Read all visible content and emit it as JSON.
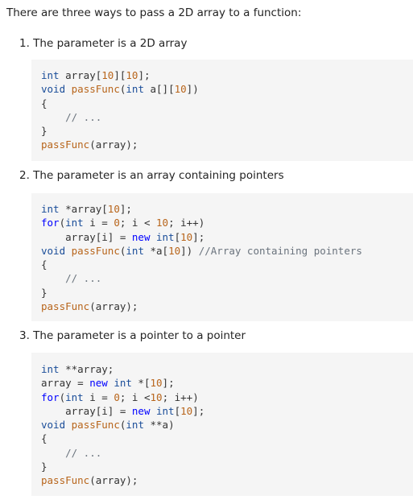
{
  "intro": "There are three ways to pass a 2D array to a function:",
  "sections": [
    {
      "heading": "1. The parameter is a 2D array",
      "code": [
        [
          [
            "ty",
            "int"
          ],
          [
            "p",
            " array["
          ],
          [
            "num",
            "10"
          ],
          [
            "p",
            "]["
          ],
          [
            "num",
            "10"
          ],
          [
            "p",
            "];"
          ]
        ],
        [
          [
            "ty",
            "void"
          ],
          [
            "p",
            " "
          ],
          [
            "fn",
            "passFunc"
          ],
          [
            "p",
            "("
          ],
          [
            "ty",
            "int"
          ],
          [
            "p",
            " a[]["
          ],
          [
            "num",
            "10"
          ],
          [
            "p",
            "])"
          ]
        ],
        [
          [
            "p",
            "{"
          ]
        ],
        [
          [
            "cm",
            "    // ..."
          ]
        ],
        [
          [
            "p",
            "}"
          ]
        ],
        [
          [
            "fn",
            "passFunc"
          ],
          [
            "p",
            "(array);"
          ]
        ]
      ]
    },
    {
      "heading": "2. The parameter is an array containing pointers",
      "code": [
        [
          [
            "ty",
            "int"
          ],
          [
            "p",
            " *array["
          ],
          [
            "num",
            "10"
          ],
          [
            "p",
            "];"
          ]
        ],
        [
          [
            "kw",
            "for"
          ],
          [
            "p",
            "("
          ],
          [
            "ty",
            "int"
          ],
          [
            "p",
            " i = "
          ],
          [
            "num",
            "0"
          ],
          [
            "p",
            "; i < "
          ],
          [
            "num",
            "10"
          ],
          [
            "p",
            "; i++)"
          ]
        ],
        [
          [
            "p",
            "    array[i] = "
          ],
          [
            "kw",
            "new"
          ],
          [
            "p",
            " "
          ],
          [
            "ty",
            "int"
          ],
          [
            "p",
            "["
          ],
          [
            "num",
            "10"
          ],
          [
            "p",
            "];"
          ]
        ],
        [
          [
            "ty",
            "void"
          ],
          [
            "p",
            " "
          ],
          [
            "fn",
            "passFunc"
          ],
          [
            "p",
            "("
          ],
          [
            "ty",
            "int"
          ],
          [
            "p",
            " *a["
          ],
          [
            "num",
            "10"
          ],
          [
            "p",
            "]) "
          ],
          [
            "cm",
            "//Array containing pointers"
          ]
        ],
        [
          [
            "p",
            "{"
          ]
        ],
        [
          [
            "cm",
            "    // ..."
          ]
        ],
        [
          [
            "p",
            "}"
          ]
        ],
        [
          [
            "fn",
            "passFunc"
          ],
          [
            "p",
            "(array);"
          ]
        ]
      ]
    },
    {
      "heading": "3. The parameter is a pointer to a pointer",
      "code": [
        [
          [
            "ty",
            "int"
          ],
          [
            "p",
            " **array;"
          ]
        ],
        [
          [
            "p",
            "array = "
          ],
          [
            "kw",
            "new"
          ],
          [
            "p",
            " "
          ],
          [
            "ty",
            "int"
          ],
          [
            "p",
            " *["
          ],
          [
            "num",
            "10"
          ],
          [
            "p",
            "];"
          ]
        ],
        [
          [
            "kw",
            "for"
          ],
          [
            "p",
            "("
          ],
          [
            "ty",
            "int"
          ],
          [
            "p",
            " i = "
          ],
          [
            "num",
            "0"
          ],
          [
            "p",
            "; i <"
          ],
          [
            "num",
            "10"
          ],
          [
            "p",
            "; i++)"
          ]
        ],
        [
          [
            "p",
            "    array[i] = "
          ],
          [
            "kw",
            "new"
          ],
          [
            "p",
            " "
          ],
          [
            "ty",
            "int"
          ],
          [
            "p",
            "["
          ],
          [
            "num",
            "10"
          ],
          [
            "p",
            "];"
          ]
        ],
        [
          [
            "ty",
            "void"
          ],
          [
            "p",
            " "
          ],
          [
            "fn",
            "passFunc"
          ],
          [
            "p",
            "("
          ],
          [
            "ty",
            "int"
          ],
          [
            "p",
            " **a)"
          ]
        ],
        [
          [
            "p",
            "{"
          ]
        ],
        [
          [
            "cm",
            "    // ..."
          ]
        ],
        [
          [
            "p",
            "}"
          ]
        ],
        [
          [
            "fn",
            "passFunc"
          ],
          [
            "p",
            "(array);"
          ]
        ]
      ]
    }
  ]
}
